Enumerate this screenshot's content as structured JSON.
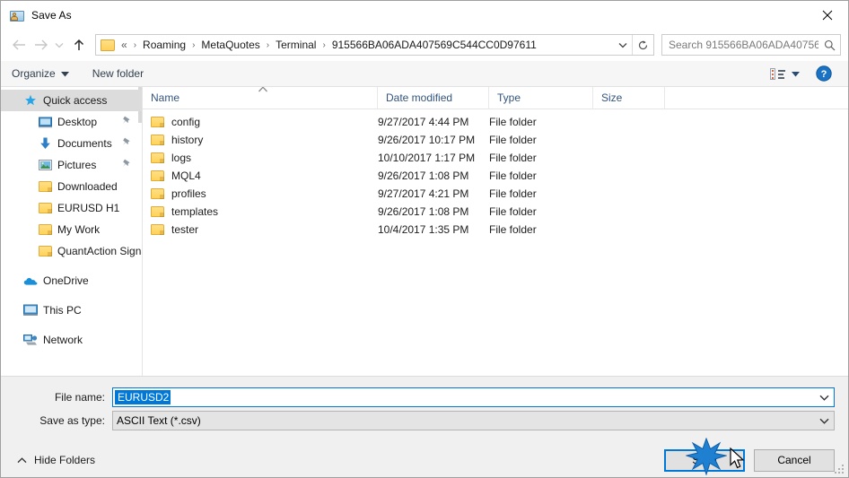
{
  "window": {
    "title": "Save As",
    "icon": "save-as-folder-person-icon",
    "close_label": "✕"
  },
  "navigation": {
    "back_icon": "back-arrow-icon",
    "forward_icon": "forward-arrow-icon",
    "recent_icon": "recent-locations-chevron-icon",
    "up_icon": "up-arrow-icon",
    "address": {
      "folder_icon": "folder-icon",
      "overflow": "«",
      "crumbs": [
        "Roaming",
        "MetaQuotes",
        "Terminal",
        "915566BA06ADA407569C544CC0D97611"
      ],
      "separator": "›",
      "dropdown_icon": "chevron-down-icon",
      "refresh_icon": "refresh-icon"
    },
    "search": {
      "placeholder": "Search 915566BA06ADA40756...",
      "icon": "search-icon"
    }
  },
  "toolbar": {
    "organize_label": "Organize",
    "organize_caret": "caret-down-icon",
    "new_folder_label": "New folder",
    "view_icon": "view-mode-icon",
    "view_caret": "caret-down-icon",
    "help_icon": "help-icon",
    "help_glyph": "?"
  },
  "sidebar": {
    "items": [
      {
        "label": "Quick access",
        "icon": "star-icon",
        "indent": 0,
        "selected": true,
        "pinned": false
      },
      {
        "label": "Desktop",
        "icon": "desktop-icon",
        "indent": 1,
        "selected": false,
        "pinned": true
      },
      {
        "label": "Documents",
        "icon": "documents-download-icon",
        "indent": 1,
        "selected": false,
        "pinned": true
      },
      {
        "label": "Pictures",
        "icon": "pictures-icon",
        "indent": 1,
        "selected": false,
        "pinned": true
      },
      {
        "label": "Downloaded",
        "icon": "folder-icon",
        "indent": 1,
        "selected": false,
        "pinned": false
      },
      {
        "label": "EURUSD H1",
        "icon": "folder-icon",
        "indent": 1,
        "selected": false,
        "pinned": false
      },
      {
        "label": "My Work",
        "icon": "folder-icon",
        "indent": 1,
        "selected": false,
        "pinned": false
      },
      {
        "label": "QuantAction Signal",
        "icon": "folder-icon",
        "indent": 1,
        "selected": false,
        "pinned": false
      },
      {
        "label": "OneDrive",
        "icon": "onedrive-cloud-icon",
        "indent": 0,
        "selected": false,
        "pinned": false,
        "gap_before": true
      },
      {
        "label": "This PC",
        "icon": "this-pc-icon",
        "indent": 0,
        "selected": false,
        "pinned": false,
        "gap_before": true
      },
      {
        "label": "Network",
        "icon": "network-icon",
        "indent": 0,
        "selected": false,
        "pinned": false,
        "gap_before": true
      }
    ]
  },
  "filelist": {
    "columns": [
      "Name",
      "Date modified",
      "Type",
      "Size"
    ],
    "sort_column": "Name",
    "sort_icon": "sort-ascending-icon",
    "rows": [
      {
        "name": "config",
        "date": "9/27/2017 4:44 PM",
        "type": "File folder",
        "size": ""
      },
      {
        "name": "history",
        "date": "9/26/2017 10:17 PM",
        "type": "File folder",
        "size": ""
      },
      {
        "name": "logs",
        "date": "10/10/2017 1:17 PM",
        "type": "File folder",
        "size": ""
      },
      {
        "name": "MQL4",
        "date": "9/26/2017 1:08 PM",
        "type": "File folder",
        "size": ""
      },
      {
        "name": "profiles",
        "date": "9/27/2017 4:21 PM",
        "type": "File folder",
        "size": ""
      },
      {
        "name": "templates",
        "date": "9/26/2017 1:08 PM",
        "type": "File folder",
        "size": ""
      },
      {
        "name": "tester",
        "date": "10/4/2017 1:35 PM",
        "type": "File folder",
        "size": ""
      }
    ]
  },
  "form": {
    "filename_label": "File name:",
    "filename_value": "EURUSD2",
    "filename_dropdown_icon": "chevron-down-icon",
    "filetype_label": "Save as type:",
    "filetype_value": "ASCII Text (*.csv)",
    "filetype_dropdown_icon": "chevron-down-icon"
  },
  "actions": {
    "hide_folders_label": "Hide Folders",
    "hide_folders_icon": "caret-up-icon",
    "save_label": "Save",
    "cancel_label": "Cancel"
  },
  "colors": {
    "accent": "#0078d7",
    "selection": "#dcdcdc",
    "folder": "#ffd357",
    "header_text": "#33557f"
  }
}
